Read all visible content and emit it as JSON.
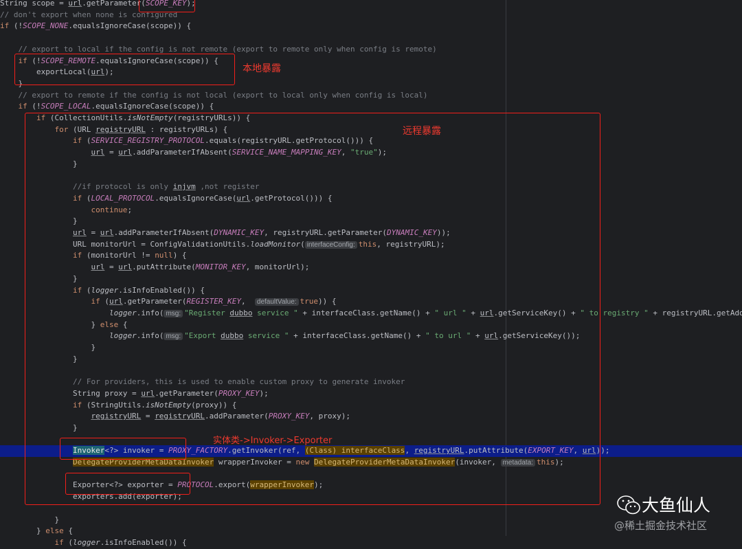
{
  "code_lines": [
    [
      [
        "t-plain",
        "String scope = "
      ],
      [
        "t-ul",
        "url"
      ],
      [
        "t-plain",
        ".getParameter("
      ],
      [
        "t-const",
        "SCOPE_KEY"
      ],
      [
        "t-plain",
        ");"
      ]
    ],
    [
      [
        "t-cmt",
        "// don't export when none is configured"
      ]
    ],
    [
      [
        "t-kw",
        "if"
      ],
      [
        "t-plain",
        " (!"
      ],
      [
        "t-const",
        "SCOPE_NONE"
      ],
      [
        "t-plain",
        ".equalsIgnoreCase(scope)) {"
      ]
    ],
    [],
    [
      [
        "t-plain",
        "    "
      ],
      [
        "t-cmt",
        "// export to local if the config is not remote (export to remote only when config is remote)"
      ]
    ],
    [
      [
        "t-plain",
        "    "
      ],
      [
        "t-kw",
        "if"
      ],
      [
        "t-plain",
        " (!"
      ],
      [
        "t-const",
        "SCOPE_REMOTE"
      ],
      [
        "t-plain",
        ".equalsIgnoreCase(scope)) {"
      ]
    ],
    [
      [
        "t-plain",
        "        exportLocal("
      ],
      [
        "t-ul",
        "url"
      ],
      [
        "t-plain",
        ");"
      ]
    ],
    [
      [
        "t-plain",
        "    }"
      ]
    ],
    [
      [
        "t-plain",
        "    "
      ],
      [
        "t-cmt",
        "// export to remote if the config is not local (export to local only when config is local)"
      ]
    ],
    [
      [
        "t-plain",
        "    "
      ],
      [
        "t-kw",
        "if"
      ],
      [
        "t-plain",
        " (!"
      ],
      [
        "t-const",
        "SCOPE_LOCAL"
      ],
      [
        "t-plain",
        ".equalsIgnoreCase(scope)) {"
      ]
    ],
    [
      [
        "t-plain",
        "        "
      ],
      [
        "t-kw",
        "if"
      ],
      [
        "t-plain",
        " (CollectionUtils."
      ],
      [
        "t-static",
        "isNotEmpty"
      ],
      [
        "t-plain",
        "(registryURLs)) {"
      ]
    ],
    [
      [
        "t-plain",
        "            "
      ],
      [
        "t-kw",
        "for"
      ],
      [
        "t-plain",
        " (URL "
      ],
      [
        "t-ul",
        "registryURL"
      ],
      [
        "t-plain",
        " : registryURLs) {"
      ]
    ],
    [
      [
        "t-plain",
        "                "
      ],
      [
        "t-kw",
        "if"
      ],
      [
        "t-plain",
        " ("
      ],
      [
        "t-const",
        "SERVICE_REGISTRY_PROTOCOL"
      ],
      [
        "t-plain",
        ".equals(registryURL.getProtocol())) {"
      ]
    ],
    [
      [
        "t-plain",
        "                    "
      ],
      [
        "t-ul",
        "url"
      ],
      [
        "t-plain",
        " = "
      ],
      [
        "t-ul",
        "url"
      ],
      [
        "t-plain",
        ".addParameterIfAbsent("
      ],
      [
        "t-const",
        "SERVICE_NAME_MAPPING_KEY"
      ],
      [
        "t-plain",
        ", "
      ],
      [
        "t-str",
        "\"true\""
      ],
      [
        "t-plain",
        ");"
      ]
    ],
    [
      [
        "t-plain",
        "                }"
      ]
    ],
    [],
    [
      [
        "t-plain",
        "                "
      ],
      [
        "t-cmt",
        "//if protocol is only "
      ],
      [
        "t-cmt t-ul",
        "injvm"
      ],
      [
        "t-cmt",
        " ,not register"
      ]
    ],
    [
      [
        "t-plain",
        "                "
      ],
      [
        "t-kw",
        "if"
      ],
      [
        "t-plain",
        " ("
      ],
      [
        "t-const",
        "LOCAL_PROTOCOL"
      ],
      [
        "t-plain",
        ".equalsIgnoreCase("
      ],
      [
        "t-ul",
        "url"
      ],
      [
        "t-plain",
        ".getProtocol())) {"
      ]
    ],
    [
      [
        "t-plain",
        "                    "
      ],
      [
        "t-kw",
        "continue"
      ],
      [
        "t-plain",
        ";"
      ]
    ],
    [
      [
        "t-plain",
        "                }"
      ]
    ],
    [
      [
        "t-plain",
        "                "
      ],
      [
        "t-ul",
        "url"
      ],
      [
        "t-plain",
        " = "
      ],
      [
        "t-ul",
        "url"
      ],
      [
        "t-plain",
        ".addParameterIfAbsent("
      ],
      [
        "t-const",
        "DYNAMIC_KEY"
      ],
      [
        "t-plain",
        ", registryURL.getParameter("
      ],
      [
        "t-const",
        "DYNAMIC_KEY"
      ],
      [
        "t-plain",
        "));"
      ]
    ],
    [
      [
        "t-plain",
        "                URL monitorUrl = ConfigValidationUtils."
      ],
      [
        "t-static",
        "loadMonitor"
      ],
      [
        "t-plain",
        "("
      ],
      [
        "t-hint",
        "interfaceConfig:"
      ],
      [
        "t-kw",
        "this"
      ],
      [
        "t-plain",
        ", registryURL);"
      ]
    ],
    [
      [
        "t-plain",
        "                "
      ],
      [
        "t-kw",
        "if"
      ],
      [
        "t-plain",
        " (monitorUrl != "
      ],
      [
        "t-kw",
        "null"
      ],
      [
        "t-plain",
        ") {"
      ]
    ],
    [
      [
        "t-plain",
        "                    "
      ],
      [
        "t-ul",
        "url"
      ],
      [
        "t-plain",
        " = "
      ],
      [
        "t-ul",
        "url"
      ],
      [
        "t-plain",
        ".putAttribute("
      ],
      [
        "t-const",
        "MONITOR_KEY"
      ],
      [
        "t-plain",
        ", monitorUrl);"
      ]
    ],
    [
      [
        "t-plain",
        "                }"
      ]
    ],
    [
      [
        "t-plain",
        "                "
      ],
      [
        "t-kw",
        "if"
      ],
      [
        "t-plain",
        " ("
      ],
      [
        "t-static",
        "logger"
      ],
      [
        "t-plain",
        ".isInfoEnabled()) {"
      ]
    ],
    [
      [
        "t-plain",
        "                    "
      ],
      [
        "t-kw",
        "if"
      ],
      [
        "t-plain",
        " ("
      ],
      [
        "t-ul",
        "url"
      ],
      [
        "t-plain",
        ".getParameter("
      ],
      [
        "t-const",
        "REGISTER_KEY"
      ],
      [
        "t-plain",
        ",  "
      ],
      [
        "t-hint",
        "defaultValue:"
      ],
      [
        "t-kw",
        "true"
      ],
      [
        "t-plain",
        ")) {"
      ]
    ],
    [
      [
        "t-plain",
        "                        "
      ],
      [
        "t-static",
        "logger"
      ],
      [
        "t-plain",
        ".info("
      ],
      [
        "t-hint",
        "msg:"
      ],
      [
        "t-str",
        "\"Register "
      ],
      [
        "t-str t-ul",
        "dubbo"
      ],
      [
        "t-str",
        " service \""
      ],
      [
        "t-plain",
        " + interfaceClass.getName() + "
      ],
      [
        "t-str",
        "\" url \""
      ],
      [
        "t-plain",
        " + "
      ],
      [
        "t-ul",
        "url"
      ],
      [
        "t-plain",
        ".getServiceKey() + "
      ],
      [
        "t-str",
        "\" to registry \""
      ],
      [
        "t-plain",
        " + registryURL.getAddr"
      ]
    ],
    [
      [
        "t-plain",
        "                    } "
      ],
      [
        "t-kw",
        "else"
      ],
      [
        "t-plain",
        " {"
      ]
    ],
    [
      [
        "t-plain",
        "                        "
      ],
      [
        "t-static",
        "logger"
      ],
      [
        "t-plain",
        ".info("
      ],
      [
        "t-hint",
        "msg:"
      ],
      [
        "t-str",
        "\"Export "
      ],
      [
        "t-str t-ul",
        "dubbo"
      ],
      [
        "t-str",
        " service \""
      ],
      [
        "t-plain",
        " + interfaceClass.getName() + "
      ],
      [
        "t-str",
        "\" to url \""
      ],
      [
        "t-plain",
        " + "
      ],
      [
        "t-ul",
        "url"
      ],
      [
        "t-plain",
        ".getServiceKey());"
      ]
    ],
    [
      [
        "t-plain",
        "                    }"
      ]
    ],
    [
      [
        "t-plain",
        "                }"
      ]
    ],
    [],
    [
      [
        "t-plain",
        "                "
      ],
      [
        "t-cmt",
        "// For providers, this is used to enable custom proxy to generate invoker"
      ]
    ],
    [
      [
        "t-plain",
        "                String proxy = "
      ],
      [
        "t-ul",
        "url"
      ],
      [
        "t-plain",
        ".getParameter("
      ],
      [
        "t-const",
        "PROXY_KEY"
      ],
      [
        "t-plain",
        ");"
      ]
    ],
    [
      [
        "t-plain",
        "                "
      ],
      [
        "t-kw",
        "if"
      ],
      [
        "t-plain",
        " (StringUtils."
      ],
      [
        "t-static",
        "isNotEmpty"
      ],
      [
        "t-plain",
        "(proxy)) {"
      ]
    ],
    [
      [
        "t-plain",
        "                    "
      ],
      [
        "t-ul",
        "registryURL"
      ],
      [
        "t-plain",
        " = "
      ],
      [
        "t-ul",
        "registryURL"
      ],
      [
        "t-plain",
        ".addParameter("
      ],
      [
        "t-const",
        "PROXY_KEY"
      ],
      [
        "t-plain",
        ", proxy);"
      ]
    ],
    [
      [
        "t-plain",
        "                }"
      ]
    ],
    [],
    [
      [
        "t-plain",
        "                "
      ],
      [
        "t-sel",
        "Invoker"
      ],
      [
        "t-plain",
        "<?> invoker = "
      ],
      [
        "t-const",
        "PROXY_FACTORY"
      ],
      [
        "t-plain",
        ".getInvoker(ref, "
      ],
      [
        "t-warn",
        "(Class) interfaceClass"
      ],
      [
        "t-plain",
        ", "
      ],
      [
        "t-ul",
        "registryURL"
      ],
      [
        "t-plain",
        ".putAttribute("
      ],
      [
        "t-const",
        "EXPORT_KEY"
      ],
      [
        "t-plain",
        ", "
      ],
      [
        "t-ul",
        "url"
      ],
      [
        "t-plain",
        "));"
      ]
    ],
    [
      [
        "t-plain",
        "                "
      ],
      [
        "t-warn",
        "DelegateProviderMetaDataInvoker"
      ],
      [
        "t-plain",
        " wrapperInvoker = "
      ],
      [
        "t-kw",
        "new"
      ],
      [
        "t-plain",
        " "
      ],
      [
        "t-warn",
        "DelegateProviderMetaDataInvoker"
      ],
      [
        "t-plain",
        "(invoker, "
      ],
      [
        "t-hint",
        "metadata:"
      ],
      [
        "t-kw",
        "this"
      ],
      [
        "t-plain",
        ");"
      ]
    ],
    [],
    [
      [
        "t-plain",
        "                Exporter<?> exporter = "
      ],
      [
        "t-const",
        "PROTOCOL"
      ],
      [
        "t-plain",
        ".export("
      ],
      [
        "t-warn",
        "wrapperInvoker"
      ],
      [
        "t-plain",
        ");"
      ]
    ],
    [
      [
        "t-plain",
        "                exporters.add(exporter);"
      ]
    ],
    [],
    [
      [
        "t-plain",
        "            }"
      ]
    ],
    [
      [
        "t-plain",
        "        } "
      ],
      [
        "t-kw",
        "else"
      ],
      [
        "t-plain",
        " {"
      ]
    ],
    [
      [
        "t-plain",
        "            "
      ],
      [
        "t-kw",
        "if"
      ],
      [
        "t-plain",
        " ("
      ],
      [
        "t-static",
        "logger"
      ],
      [
        "t-plain",
        ".isInfoEnabled()) {"
      ]
    ]
  ],
  "highlighted_line": 39,
  "annotations": {
    "local_expose": "本地暴露",
    "remote_expose": "远程暴露",
    "chain": "实体类->Invoker->Exporter"
  },
  "watermark": {
    "name": "大鱼仙人",
    "sub": "@稀土掘金技术社区"
  },
  "colors": {
    "background": "#1e1f22",
    "annotation_red": "#f41f1a",
    "highlight_line": "#0c1d8a"
  }
}
